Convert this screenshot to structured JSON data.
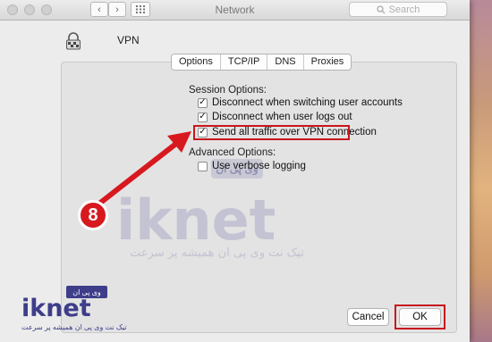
{
  "window": {
    "title": "Network"
  },
  "search": {
    "placeholder": "Search"
  },
  "vpn": {
    "name": "VPN"
  },
  "tabs": [
    {
      "label": "Options",
      "active": true
    },
    {
      "label": "TCP/IP",
      "active": false
    },
    {
      "label": "DNS",
      "active": false
    },
    {
      "label": "Proxies",
      "active": false
    }
  ],
  "session": {
    "label": "Session Options:",
    "options": [
      {
        "label": "Disconnect when switching user accounts",
        "checked": true
      },
      {
        "label": "Disconnect when user logs out",
        "checked": true
      },
      {
        "label": "Send all traffic over VPN connection",
        "checked": true
      }
    ]
  },
  "advanced": {
    "label": "Advanced Options:",
    "options": [
      {
        "label": "Use verbose logging",
        "checked": false
      }
    ]
  },
  "buttons": {
    "cancel": "Cancel",
    "ok": "OK"
  },
  "annotation": {
    "step": "8",
    "color": "#d7191f"
  },
  "watermark": {
    "brand": "iknet",
    "tagline": "تیک نت وی پی ان همیشه پر سرعت",
    "tag": "وی پی ان"
  },
  "colors": {
    "highlight": "#c8161d",
    "brand": "#3d3d8a"
  }
}
